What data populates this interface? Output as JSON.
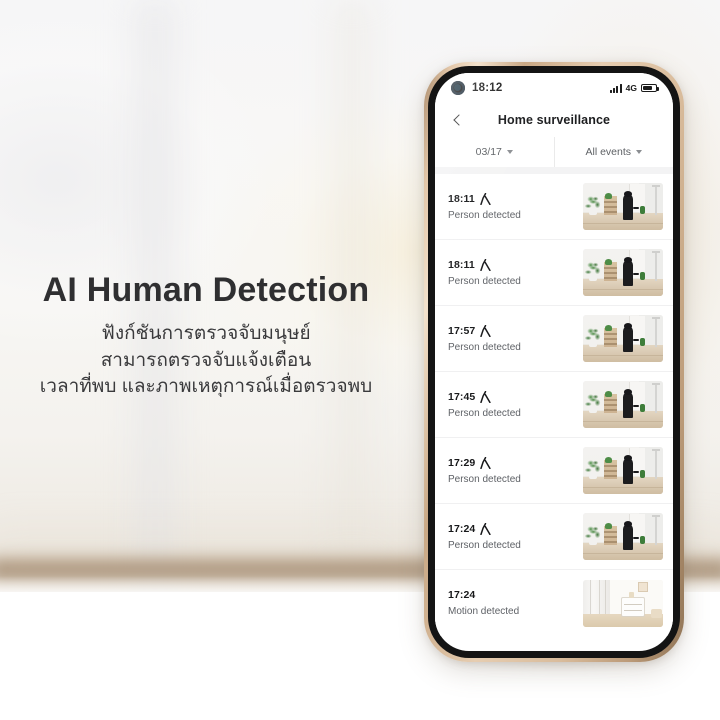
{
  "marketing": {
    "headline": "AI Human Detection",
    "subcopy_line1": "ฟังก์ชันการตรวจจับมนุษย์",
    "subcopy_line2": "สามารถตรวจจับแจ้งเตือน",
    "subcopy_line3": "เวลาที่พบ และภาพเหตุการณ์เมื่อตรวจพบ"
  },
  "phone": {
    "status_bar": {
      "time": "18:12",
      "network": "4G",
      "signal_icon": "signal-bars-icon",
      "battery_icon": "battery-icon",
      "camera_icon": "front-camera-punch-hole"
    },
    "nav": {
      "back_icon": "chevron-left-icon",
      "title": "Home surveillance"
    },
    "filters": [
      {
        "label": "03/17",
        "caret_icon": "caret-down-icon"
      },
      {
        "label": "All events",
        "caret_icon": "caret-down-icon"
      }
    ],
    "events": [
      {
        "time": "18:11",
        "label": "Person detected",
        "icon": "person-detected-icon",
        "thumbnail": "room-person-at-door"
      },
      {
        "time": "18:11",
        "label": "Person detected",
        "icon": "person-detected-icon",
        "thumbnail": "room-person-at-door"
      },
      {
        "time": "17:57",
        "label": "Person detected",
        "icon": "person-detected-icon",
        "thumbnail": "room-person-at-door"
      },
      {
        "time": "17:45",
        "label": "Person detected",
        "icon": "person-detected-icon",
        "thumbnail": "room-person-at-door"
      },
      {
        "time": "17:29",
        "label": "Person detected",
        "icon": "person-detected-icon",
        "thumbnail": "room-person-at-door"
      },
      {
        "time": "17:24",
        "label": "Person detected",
        "icon": "person-detected-icon",
        "thumbnail": "room-person-at-door"
      },
      {
        "time": "17:24",
        "label": "Motion detected",
        "icon": "",
        "thumbnail": "bright-room-dresser"
      }
    ]
  },
  "colors": {
    "headline_text": "#2f2f31",
    "body_text": "#3a3a3c",
    "phone_frame_gold": "#d9bc9c",
    "screen_background": "#ffffff",
    "event_label_gray": "#5e6166"
  }
}
